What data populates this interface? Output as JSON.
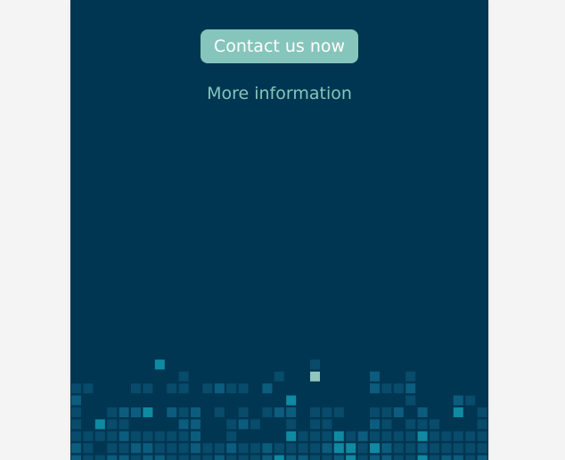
{
  "cta": {
    "contact_label": "Contact us now",
    "more_label": "More information"
  },
  "colors": {
    "panel_bg": "#003651",
    "page_bg": "#f4f4f4",
    "accent": "#86c5bb",
    "pixel_dark": "#084b6b",
    "pixel_mid": "#0c5c7e",
    "pixel_teal": "#0f8aa3",
    "pixel_light": "#8fc7bd"
  }
}
